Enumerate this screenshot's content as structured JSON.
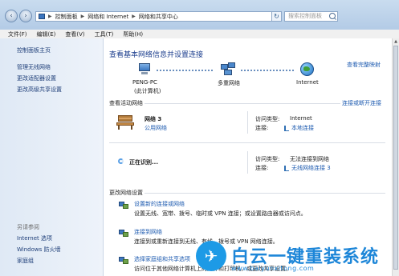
{
  "address_bar": {
    "crumbs": [
      "控制面板",
      "网络和 Internet",
      "网络和共享中心"
    ],
    "search_placeholder": "搜索控制面板"
  },
  "menu": [
    "文件(F)",
    "编辑(E)",
    "查看(V)",
    "工具(T)",
    "帮助(H)"
  ],
  "sidebar": {
    "links": [
      "控制面板主页",
      "管理无线网络",
      "更改适配器设置",
      "更改高级共享设置"
    ],
    "see_also": "另请参阅",
    "see_also_links": [
      "Internet 选项",
      "Windows 防火墙",
      "家庭组"
    ]
  },
  "main": {
    "title": "查看基本网络信息并设置连接",
    "full_map": "查看完整映射",
    "map_nodes": [
      {
        "label": "PENG-PC",
        "sub": "(此计算机)"
      },
      {
        "label": "多重网络",
        "sub": ""
      },
      {
        "label": "Internet",
        "sub": ""
      }
    ],
    "active_networks_heading": "查看活动网络",
    "connect_disconnect": "连接或断开连接",
    "network1": {
      "name": "网络  3",
      "type": "公用网络",
      "access_label": "访问类型:",
      "access_value": "Internet",
      "conn_label": "连接:",
      "conn_value": "本地连接"
    },
    "network2": {
      "name": "正在识别...",
      "access_label": "访问类型:",
      "access_value": "无法连接到网络",
      "conn_label": "连接:",
      "conn_value": "无线网络连接 3"
    },
    "change_heading": "更改网络设置",
    "tasks": [
      {
        "title": "设置新的连接或网络",
        "desc": "设置无线、宽带、拨号、临时或 VPN 连接；或设置路由器或访问点。"
      },
      {
        "title": "连接到网络",
        "desc": "连接到或重新连接到无线、有线、拨号或 VPN 网络连接。"
      },
      {
        "title": "选择家庭组和共享选项",
        "desc": "访问位于其他网络计算机上的文件和打印机，或更改共享设置。"
      }
    ]
  },
  "watermark": {
    "name": "白云一键重装系统",
    "url": "www.baiyunxitong.com"
  }
}
